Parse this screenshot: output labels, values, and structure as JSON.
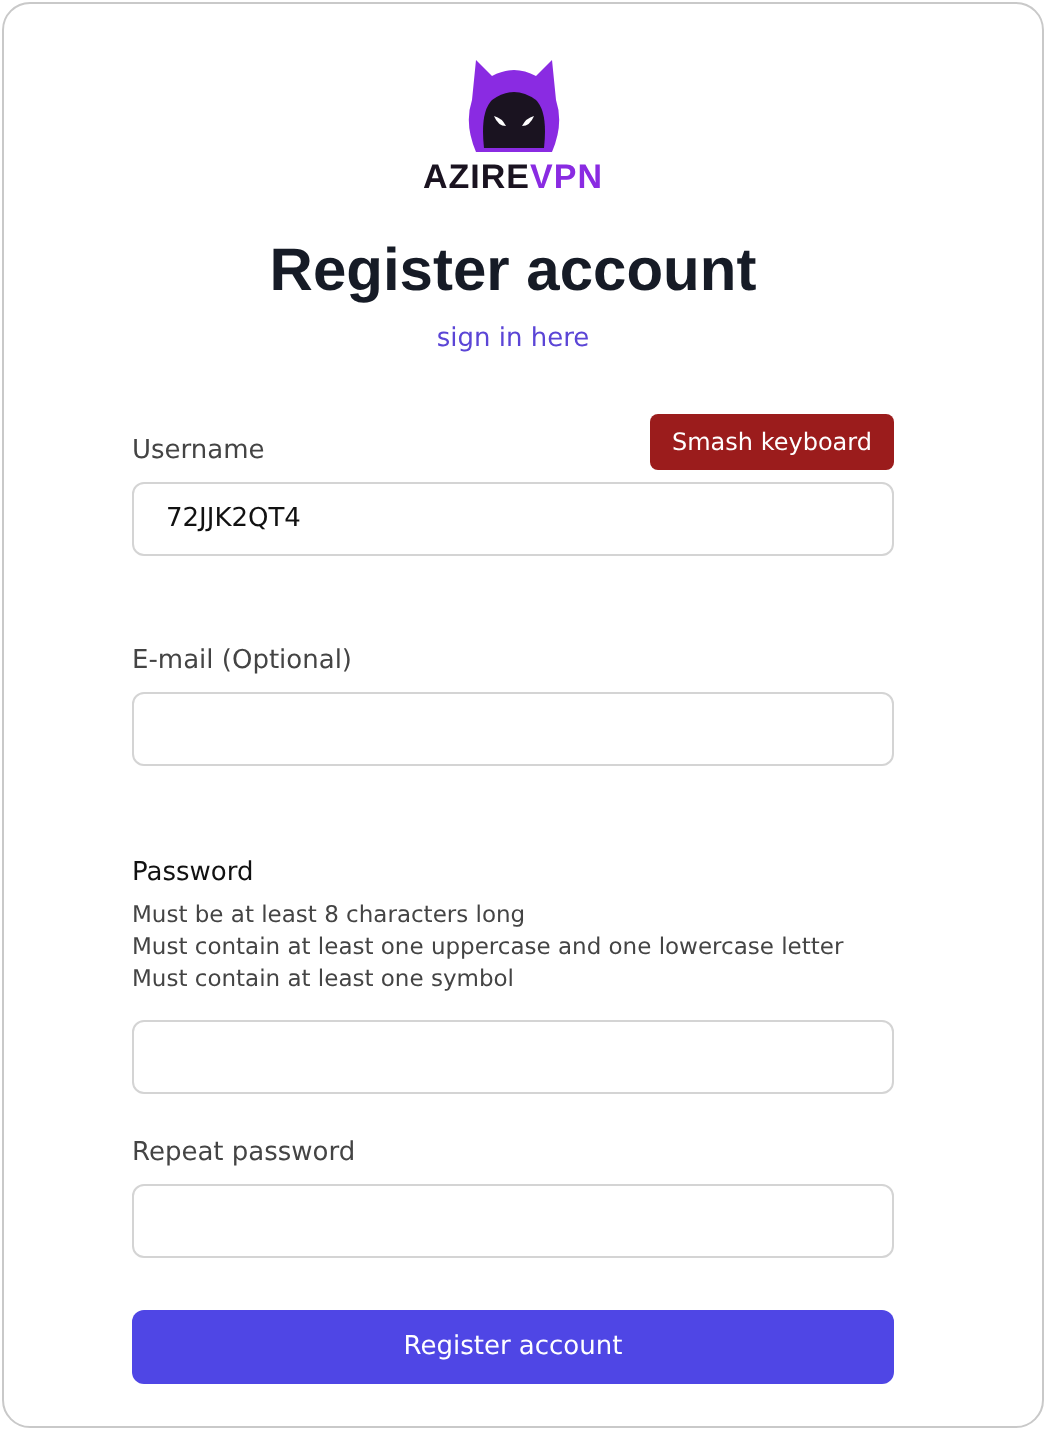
{
  "logo": {
    "text": "AZIRE",
    "accent": "VPN"
  },
  "title": "Register account",
  "signin_link": "sign in here",
  "fields": [
    {
      "kind": "generator",
      "label": "Username",
      "value": "72JJK2QT4",
      "button": "Smash keyboard"
    },
    {
      "kind": "plain",
      "label": "E-mail (Optional)"
    },
    {
      "kind": "hints",
      "label": "Password",
      "hints": [
        "Must be at least 8 characters long",
        "Must contain at least one uppercase and one lowercase letter",
        "Must contain at least one symbol"
      ]
    },
    {
      "kind": "plain",
      "label": "Repeat password"
    }
  ],
  "submit": "Register account"
}
